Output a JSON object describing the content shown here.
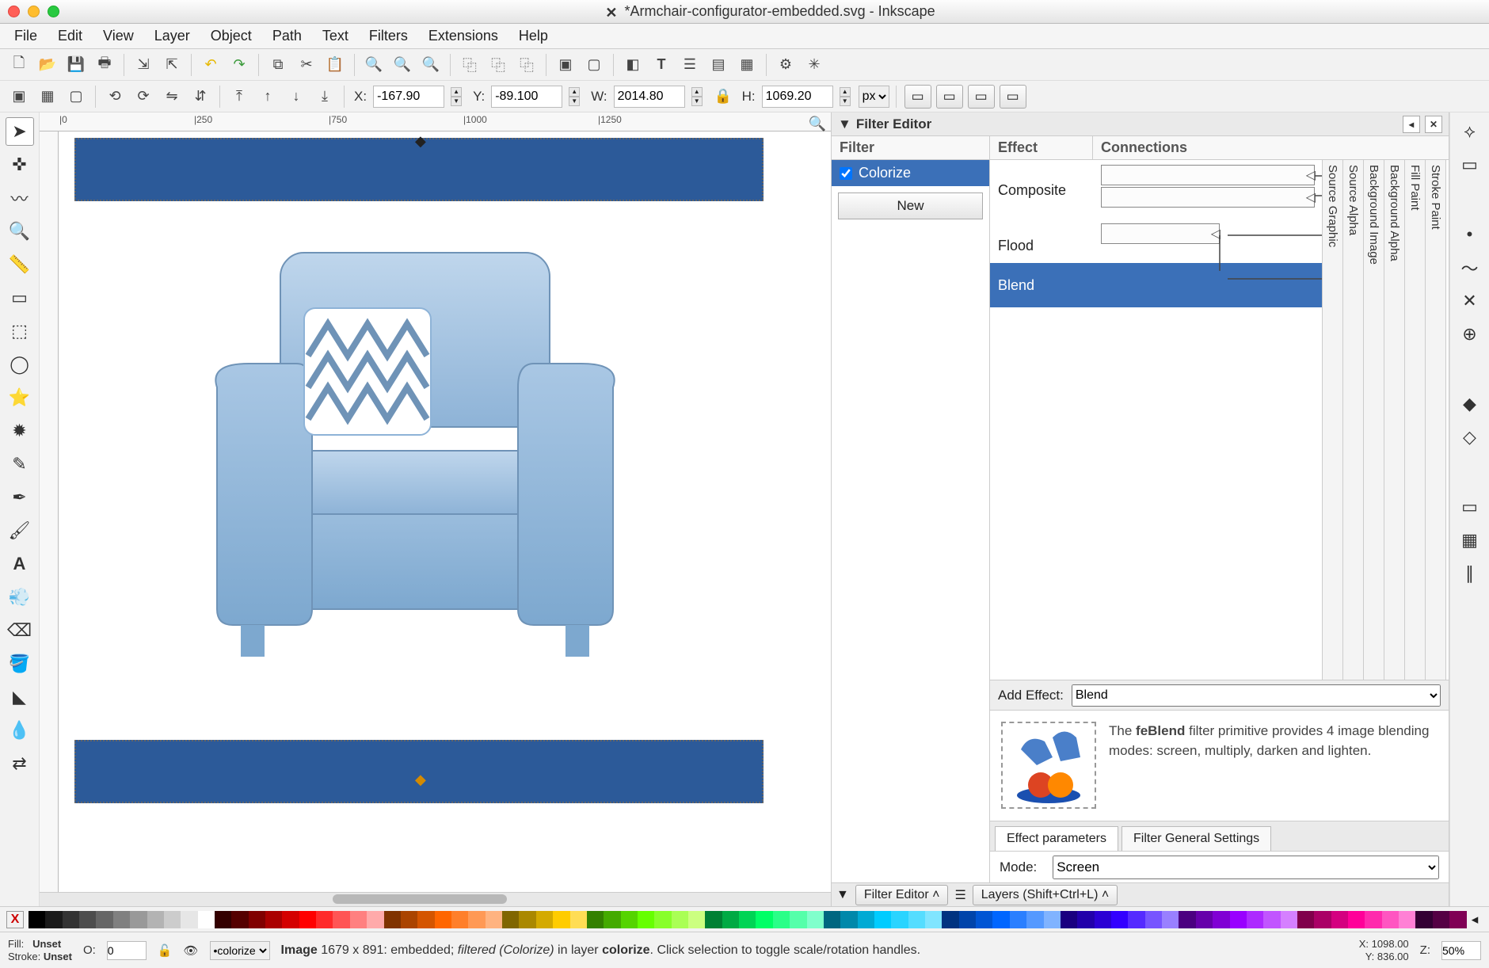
{
  "titlebar": {
    "title": "*Armchair-configurator-embedded.svg - Inkscape"
  },
  "menu": [
    "File",
    "Edit",
    "View",
    "Layer",
    "Object",
    "Path",
    "Text",
    "Filters",
    "Extensions",
    "Help"
  ],
  "toolbar2": {
    "x_label": "X:",
    "x_value": "-167.90",
    "y_label": "Y:",
    "y_value": "-89.100",
    "w_label": "W:",
    "w_value": "2014.80",
    "h_label": "H:",
    "h_value": "1069.20",
    "unit": "px"
  },
  "ruler_ticks": [
    {
      "pos": 25,
      "label": "|0"
    },
    {
      "pos": 195,
      "label": "|250"
    },
    {
      "pos": 365,
      "label": "|750"
    },
    {
      "pos": 535,
      "label": "|1000"
    },
    {
      "pos": 705,
      "label": "|1250"
    }
  ],
  "panel": {
    "title": "Filter Editor",
    "filter_col": "Filter",
    "filter_name": "Colorize",
    "new_btn": "New",
    "effect_col": "Effect",
    "conn_col": "Connections",
    "effects": [
      "Composite",
      "Flood",
      "Blend"
    ],
    "src_cols": [
      "Source Graphic",
      "Source Alpha",
      "Background Image",
      "Background Alpha",
      "Fill Paint",
      "Stroke Paint"
    ],
    "add_label": "Add Effect:",
    "add_value": "Blend",
    "desc_bold": "feBlend",
    "desc_pre": "The ",
    "desc_rest": " filter primitive provides 4 image blending modes: screen, multiply, darken and lighten.",
    "tab1": "Effect parameters",
    "tab2": "Filter General Settings",
    "mode_label": "Mode:",
    "mode_value": "Screen"
  },
  "docktabs": {
    "a": "Filter Editor",
    "b": "Layers (Shift+Ctrl+L)"
  },
  "status": {
    "fill_lbl": "Fill:",
    "fill_val": "Unset",
    "stroke_lbl": "Stroke:",
    "stroke_val": "Unset",
    "o_lbl": "O:",
    "o_val": "0",
    "layer": "•colorize",
    "message_a": "Image",
    "message_b": " 1679 x 891: embedded; ",
    "message_c": "filtered (Colorize)",
    "message_d": " in layer ",
    "message_e": "colorize",
    "message_f": ". Click selection to toggle scale/rotation handles.",
    "coord_x": "X: 1098.00",
    "coord_y": "Y:  836.00",
    "z_lbl": "Z:",
    "z_val": "50%"
  },
  "palette_colors": [
    "#000000",
    "#1a1a1a",
    "#333333",
    "#4d4d4d",
    "#666666",
    "#808080",
    "#999999",
    "#b3b3b3",
    "#cccccc",
    "#e6e6e6",
    "#ffffff",
    "#330000",
    "#550000",
    "#800000",
    "#aa0000",
    "#d40000",
    "#ff0000",
    "#ff2a2a",
    "#ff5555",
    "#ff8080",
    "#ffaaaa",
    "#803300",
    "#aa4400",
    "#d45500",
    "#ff6600",
    "#ff7f2a",
    "#ff9955",
    "#ffb380",
    "#806600",
    "#aa8800",
    "#d4aa00",
    "#ffcc00",
    "#ffdd55",
    "#338000",
    "#44aa00",
    "#55d400",
    "#66ff00",
    "#88ff2a",
    "#aaff55",
    "#ccff80",
    "#008033",
    "#00aa44",
    "#00d455",
    "#00ff66",
    "#2aff88",
    "#55ffaa",
    "#80ffcc",
    "#006680",
    "#0088aa",
    "#00aad4",
    "#00ccff",
    "#2ad4ff",
    "#55ddff",
    "#80e5ff",
    "#003380",
    "#0044aa",
    "#0055d4",
    "#0066ff",
    "#2a7fff",
    "#5599ff",
    "#80b3ff",
    "#1a0080",
    "#2200aa",
    "#2b00d4",
    "#3300ff",
    "#552aff",
    "#7755ff",
    "#9980ff",
    "#4b0080",
    "#6600aa",
    "#8000d4",
    "#9900ff",
    "#ad2aff",
    "#c155ff",
    "#d580ff",
    "#80004b",
    "#aa0066",
    "#d40080",
    "#ff0099",
    "#ff2aad",
    "#ff55c1",
    "#ff80d5",
    "#330033",
    "#550044",
    "#800055"
  ]
}
